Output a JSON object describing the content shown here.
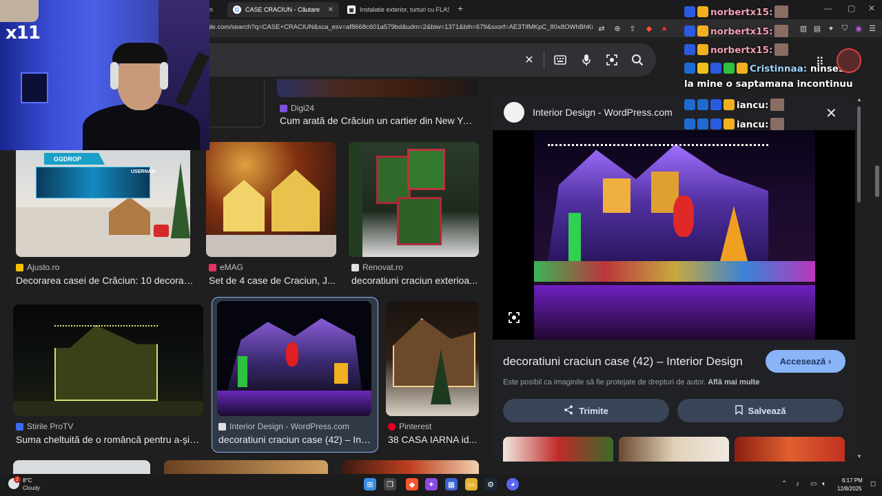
{
  "tabs": [
    {
      "label": "n",
      "active": false
    },
    {
      "label": "CASE CRACIUN - Căutare Google",
      "active": true
    },
    {
      "label": "Instalatie exterior, turturi cu FLASH, 2",
      "active": false
    }
  ],
  "address": {
    "url": "gle.com/search?q=CASE+CRACIUN&sca_esv=af8668c601a579bd&udm=2&biw=1371&bih=679&sxsrf=AE3TifMKpC_80x8OWhBhKrdf..."
  },
  "results": [
    {
      "source": "Digi24",
      "title": "Cum arată de Crăciun un cartier din New Yor..."
    },
    {
      "source": "Ajusto.ro",
      "title": "Decorarea casei de Crăciun: 10 decorați..."
    },
    {
      "source": "eMAG",
      "title": "Set de 4 case de Craciun, J..."
    },
    {
      "source": "Renovat.ro",
      "title": "decoratiuni craciun exterioa..."
    },
    {
      "source": "Stirile ProTV",
      "title": "Suma cheltuită de o româncă pentru a-și d..."
    },
    {
      "source": "Interior Design - WordPress.com",
      "title": "decoratiuni craciun case (42) – Int..."
    },
    {
      "source": "Pinterest",
      "title": "38 CASA IARNA id..."
    }
  ],
  "panel": {
    "site": "Interior Design - WordPress.com",
    "title": "decoratiuni craciun case (42) – Interior Design",
    "visit": "Accesează",
    "copyright": "Este posibil ca imaginile să fie protejate de drepturi de autor.",
    "learn_more": "Află mai multe",
    "share": "Trimite",
    "save": "Salvează"
  },
  "overlay": {
    "cam_label": "x11",
    "gg_label": "GGDROP",
    "gg_user": "USERNAM"
  },
  "chat": [
    {
      "name": "norbertx15:",
      "msg": ""
    },
    {
      "name": "norbertx15:",
      "msg": ""
    },
    {
      "name": "norbertx15:",
      "msg": ""
    },
    {
      "name": "Cristinnaa:",
      "msg": "ninsese"
    },
    {
      "name": "",
      "msg": "la mine o saptamana incontinuu"
    },
    {
      "name": "iancu:",
      "msg": ""
    },
    {
      "name": "iancu:",
      "msg": ""
    }
  ],
  "taskbar": {
    "temp": "8°C",
    "cond": "Cloudy",
    "time": "6:17 PM",
    "date": "12/8/2025",
    "notif": "2"
  },
  "colors": {
    "accent": "#8ab4f8",
    "panel_btn": "#394457",
    "bg": "#1f1f1f"
  }
}
